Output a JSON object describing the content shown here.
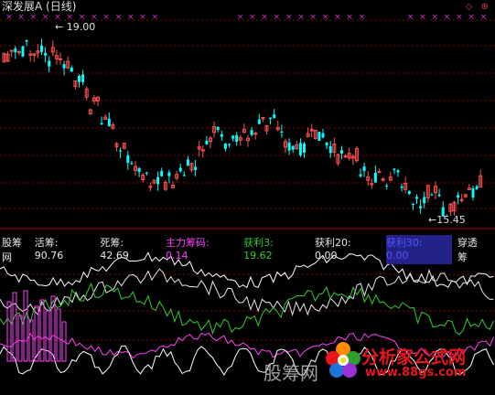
{
  "title": "深发展A (日线)",
  "markers": {
    "high_label": "19.00",
    "low_label": "15.45"
  },
  "indicator": {
    "name": "股筹网",
    "items": [
      {
        "label": "活筹:",
        "value": "90.76",
        "color": "#e6e6e6"
      },
      {
        "label": "死筹:",
        "value": "42.69",
        "color": "#e6e6e6"
      },
      {
        "label": "主力筹码:",
        "value": "0.14",
        "color": "#ff40ff"
      },
      {
        "label": "获利3:",
        "value": "19.62",
        "color": "#33cc33"
      },
      {
        "label": "获利20:",
        "value": "0.00",
        "color": "#e6e6e6"
      },
      {
        "label": "获利30:",
        "value": "0.00",
        "color": "#5555ff"
      },
      {
        "label": "穿透筹",
        "value": "",
        "color": "#e6e6e6"
      }
    ]
  },
  "watermark": {
    "name": "分析家公式网",
    "url": "www.88gs.com"
  },
  "ghost_text": "股筹网",
  "colors": {
    "up": "#ff5050",
    "down": "#00ffff",
    "marker": "#cc33cc",
    "grid": "#8b0000"
  },
  "icons": {
    "control": "window-control-icons"
  }
}
